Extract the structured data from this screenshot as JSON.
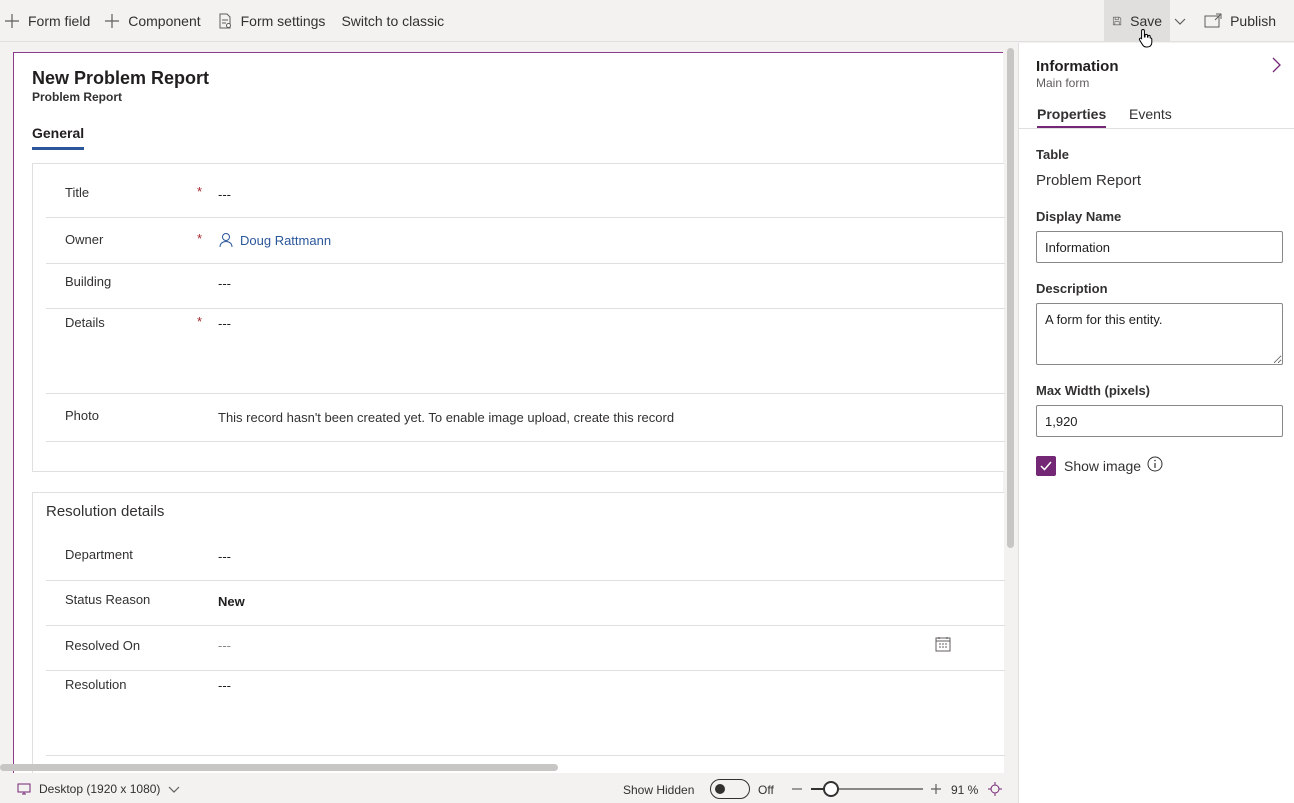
{
  "toolbar": {
    "form_field": "Form field",
    "component": "Component",
    "form_settings": "Form settings",
    "switch_classic": "Switch to classic",
    "save": "Save",
    "publish": "Publish"
  },
  "form": {
    "title": "New Problem Report",
    "subtitle": "Problem Report",
    "tab": "General",
    "fields": {
      "title_label": "Title",
      "title_value": "---",
      "owner_label": "Owner",
      "owner_value": "Doug Rattmann",
      "building_label": "Building",
      "building_value": "---",
      "details_label": "Details",
      "details_value": "---",
      "photo_label": "Photo",
      "photo_value": "This record hasn't been created yet. To enable image upload, create this record"
    },
    "required_marker": "*",
    "resolution": {
      "title": "Resolution details",
      "department_label": "Department",
      "department_value": "---",
      "status_label": "Status Reason",
      "status_value": "New",
      "resolved_label": "Resolved On",
      "resolved_value": "---",
      "resolution_label": "Resolution",
      "resolution_value": "---"
    }
  },
  "statusbar": {
    "device": "Desktop (1920 x 1080)",
    "show_hidden": "Show Hidden",
    "toggle_state": "Off",
    "zoom_percent": "91 %",
    "zoom_value": 91
  },
  "panel": {
    "title": "Information",
    "subtitle": "Main form",
    "tabs": [
      "Properties",
      "Events"
    ],
    "table_label": "Table",
    "table_value": "Problem Report",
    "display_name_label": "Display Name",
    "display_name_value": "Information",
    "description_label": "Description",
    "description_value": "A form for this entity.",
    "max_width_label": "Max Width (pixels)",
    "max_width_value": "1,920",
    "show_image_label": "Show image",
    "show_image_checked": true
  },
  "colors": {
    "accent": "#742774",
    "link": "#2b579a",
    "required": "#a4262c"
  }
}
